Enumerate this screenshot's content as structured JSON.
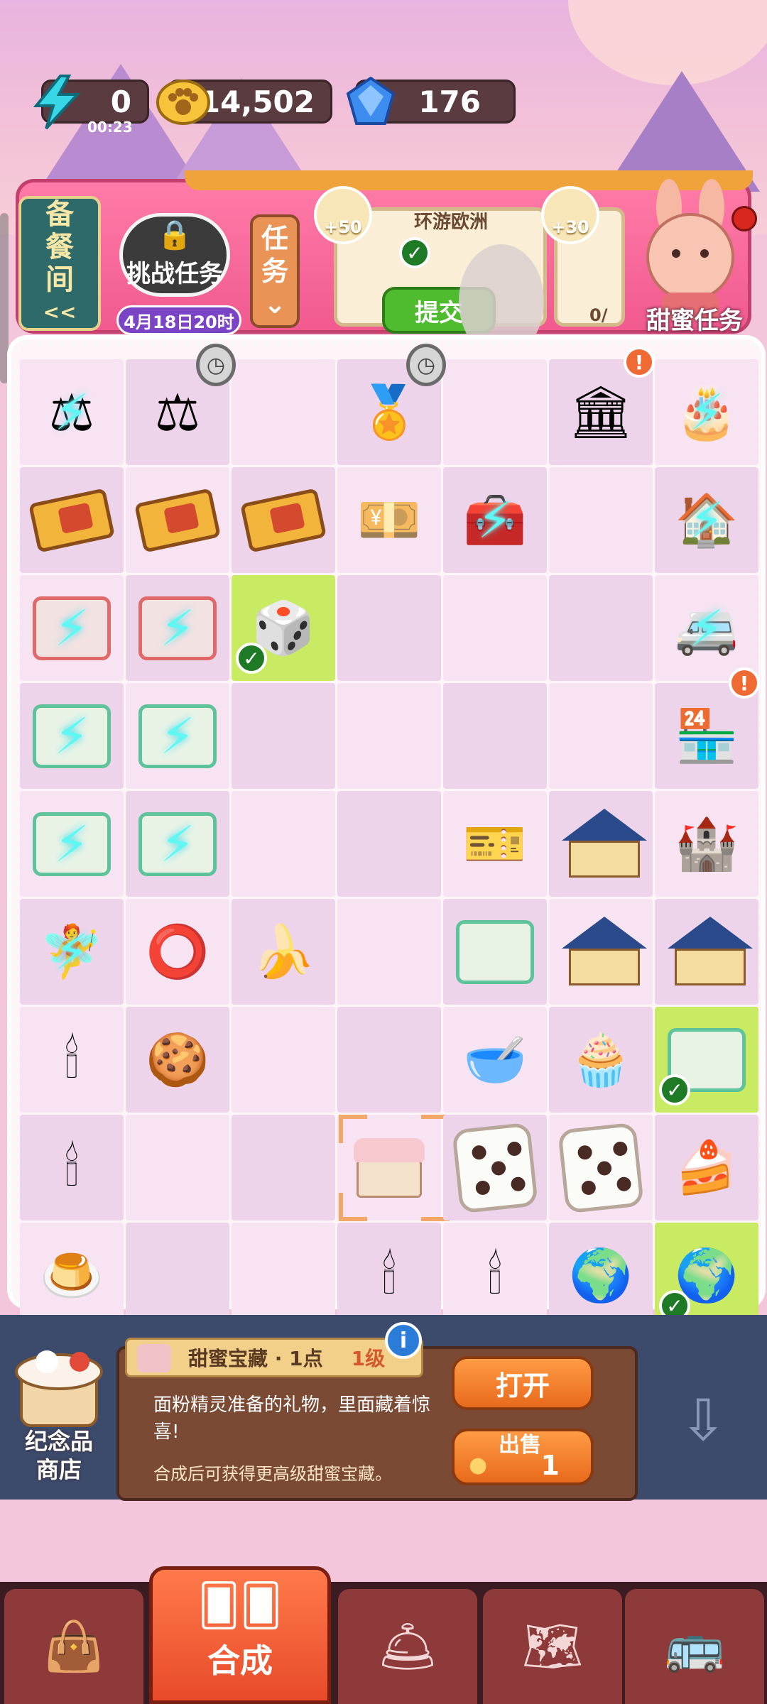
{
  "resources": {
    "energy": {
      "value": "0",
      "timer": "00:23",
      "icon": "lightning-icon"
    },
    "coins": {
      "value": "14,502",
      "icon": "paw-coin-icon"
    },
    "gems": {
      "value": "176",
      "icon": "blue-gem-icon"
    }
  },
  "banner": {
    "side_tab": [
      "备",
      "餐",
      "间",
      "<<"
    ],
    "challenge": {
      "title": "挑战任务",
      "date": "4月18日20时"
    },
    "task_tab": [
      "任",
      "务",
      "⌄"
    ],
    "card_title": "环游欧洲",
    "rewards": [
      "+50",
      "+30"
    ],
    "submit_label": "提交",
    "partial_count": "0/",
    "sweet_task_label": "甜蜜任务"
  },
  "board": {
    "columns": 7,
    "rows": 9,
    "cells": [
      [
        "scale-bolt",
        "scale",
        "empty",
        "medal-cake",
        "empty",
        "bank",
        "cake-bolt"
      ],
      [
        "coupon",
        "coupon",
        "coupon",
        "cash-10k",
        "chest-bolt",
        "empty",
        "house-bolt"
      ],
      [
        "cash-red-bolt",
        "cash-red-bolt",
        "dice-frame",
        "empty",
        "empty",
        "empty",
        "caravan-bolt"
      ],
      [
        "cash-green-bolt",
        "cash-green-bolt",
        "empty",
        "empty",
        "empty",
        "empty",
        "shop"
      ],
      [
        "cash-green-bolt",
        "cash-green-bolt",
        "empty",
        "empty",
        "ticket",
        "villa",
        "palace"
      ],
      [
        "fairy-bolt",
        "manhole",
        "banana",
        "empty",
        "tickets",
        "villa",
        "villa"
      ],
      [
        "candelabra",
        "cookie",
        "empty",
        "empty",
        "mixer",
        "cupcake",
        "tickets-done"
      ],
      [
        "candelabra",
        "empty",
        "empty",
        "cake-selected",
        "dice",
        "dice",
        "cake-cherry"
      ],
      [
        "pudding",
        "empty",
        "empty",
        "candle",
        "candle",
        "globe",
        "globe-done"
      ]
    ]
  },
  "info": {
    "item_name": "甜蜜宝藏 · 1点",
    "level": "1级",
    "description": "面粉精灵准备的礼物，里面藏着惊喜!",
    "hint": "合成后可获得更高级甜蜜宝藏。",
    "open_label": "打开",
    "sell_label": "出售",
    "sell_price": "1",
    "shop_label": [
      "纪念品",
      "商店"
    ]
  },
  "nav": {
    "active_label": "合成",
    "items": [
      "bag-icon",
      "cloche-icon",
      "map-pin-icon",
      "bus-icon"
    ]
  }
}
